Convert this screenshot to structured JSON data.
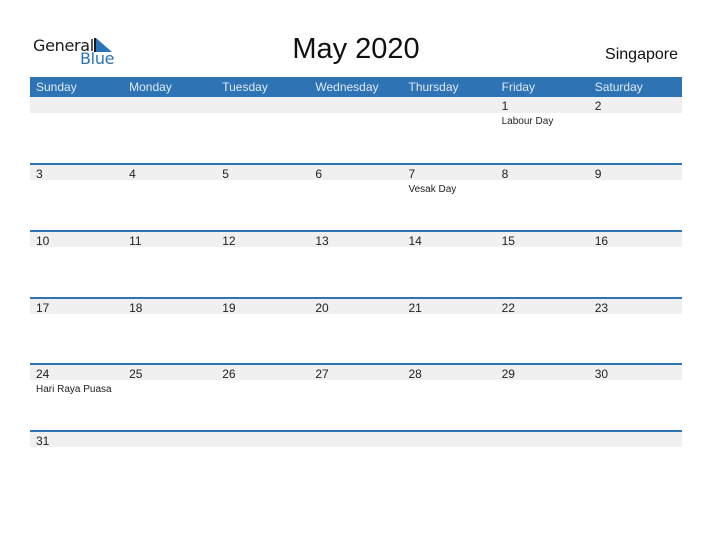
{
  "logo": {
    "line1": "General",
    "line2": "Blue"
  },
  "title": "May 2020",
  "country": "Singapore",
  "days": [
    "Sunday",
    "Monday",
    "Tuesday",
    "Wednesday",
    "Thursday",
    "Friday",
    "Saturday"
  ],
  "weeks": [
    [
      {
        "d": ""
      },
      {
        "d": ""
      },
      {
        "d": ""
      },
      {
        "d": ""
      },
      {
        "d": ""
      },
      {
        "d": "1",
        "h": "Labour Day"
      },
      {
        "d": "2"
      }
    ],
    [
      {
        "d": "3"
      },
      {
        "d": "4"
      },
      {
        "d": "5"
      },
      {
        "d": "6"
      },
      {
        "d": "7",
        "h": "Vesak Day"
      },
      {
        "d": "8"
      },
      {
        "d": "9"
      }
    ],
    [
      {
        "d": "10"
      },
      {
        "d": "11"
      },
      {
        "d": "12"
      },
      {
        "d": "13"
      },
      {
        "d": "14"
      },
      {
        "d": "15"
      },
      {
        "d": "16"
      }
    ],
    [
      {
        "d": "17"
      },
      {
        "d": "18"
      },
      {
        "d": "19"
      },
      {
        "d": "20"
      },
      {
        "d": "21"
      },
      {
        "d": "22"
      },
      {
        "d": "23"
      }
    ],
    [
      {
        "d": "24",
        "h": "Hari Raya Puasa"
      },
      {
        "d": "25"
      },
      {
        "d": "26"
      },
      {
        "d": "27"
      },
      {
        "d": "28"
      },
      {
        "d": "29"
      },
      {
        "d": "30"
      }
    ],
    [
      {
        "d": "31"
      },
      {
        "d": ""
      },
      {
        "d": ""
      },
      {
        "d": ""
      },
      {
        "d": ""
      },
      {
        "d": ""
      },
      {
        "d": ""
      }
    ]
  ],
  "colors": {
    "accent": "#2e74b5",
    "band": "#f0f0f0"
  }
}
